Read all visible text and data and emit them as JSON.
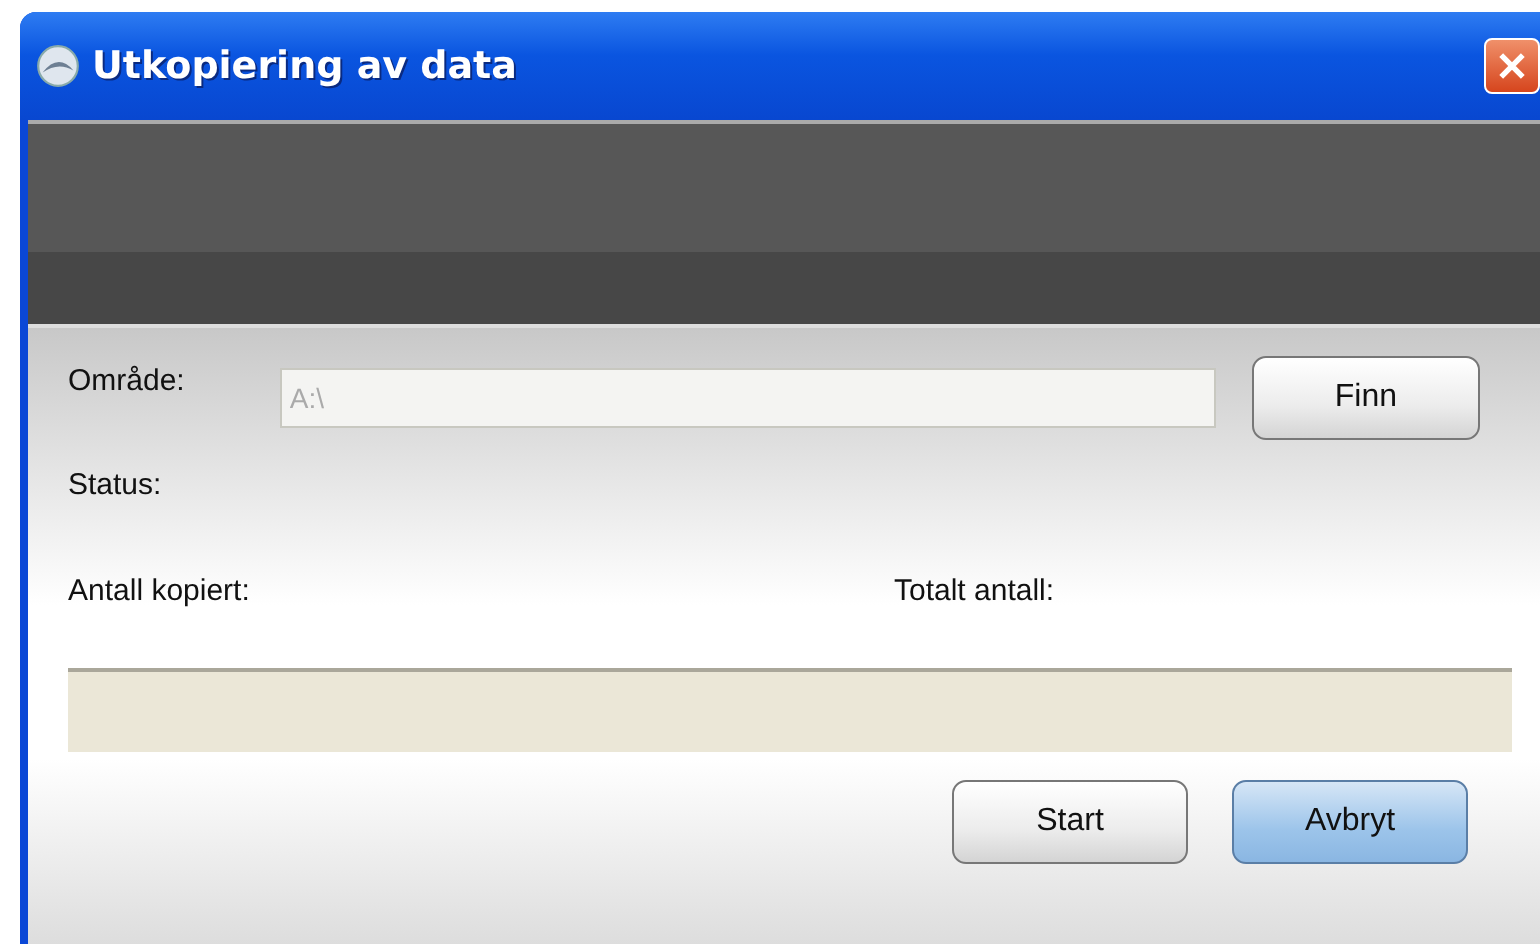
{
  "window": {
    "title": "Utkopiering av data"
  },
  "area": {
    "label": "Område:",
    "value": "A:\\",
    "disabled": true
  },
  "find_button": {
    "label": "Finn",
    "default": false
  },
  "status": {
    "label": "Status:"
  },
  "copied": {
    "label": "Antall kopiert:"
  },
  "total": {
    "label": "Totalt antall:"
  },
  "progress": {
    "level": 0
  },
  "buttons": [
    {
      "label": "Start",
      "default": false
    },
    {
      "label": "Avbryt",
      "default": true
    }
  ]
}
